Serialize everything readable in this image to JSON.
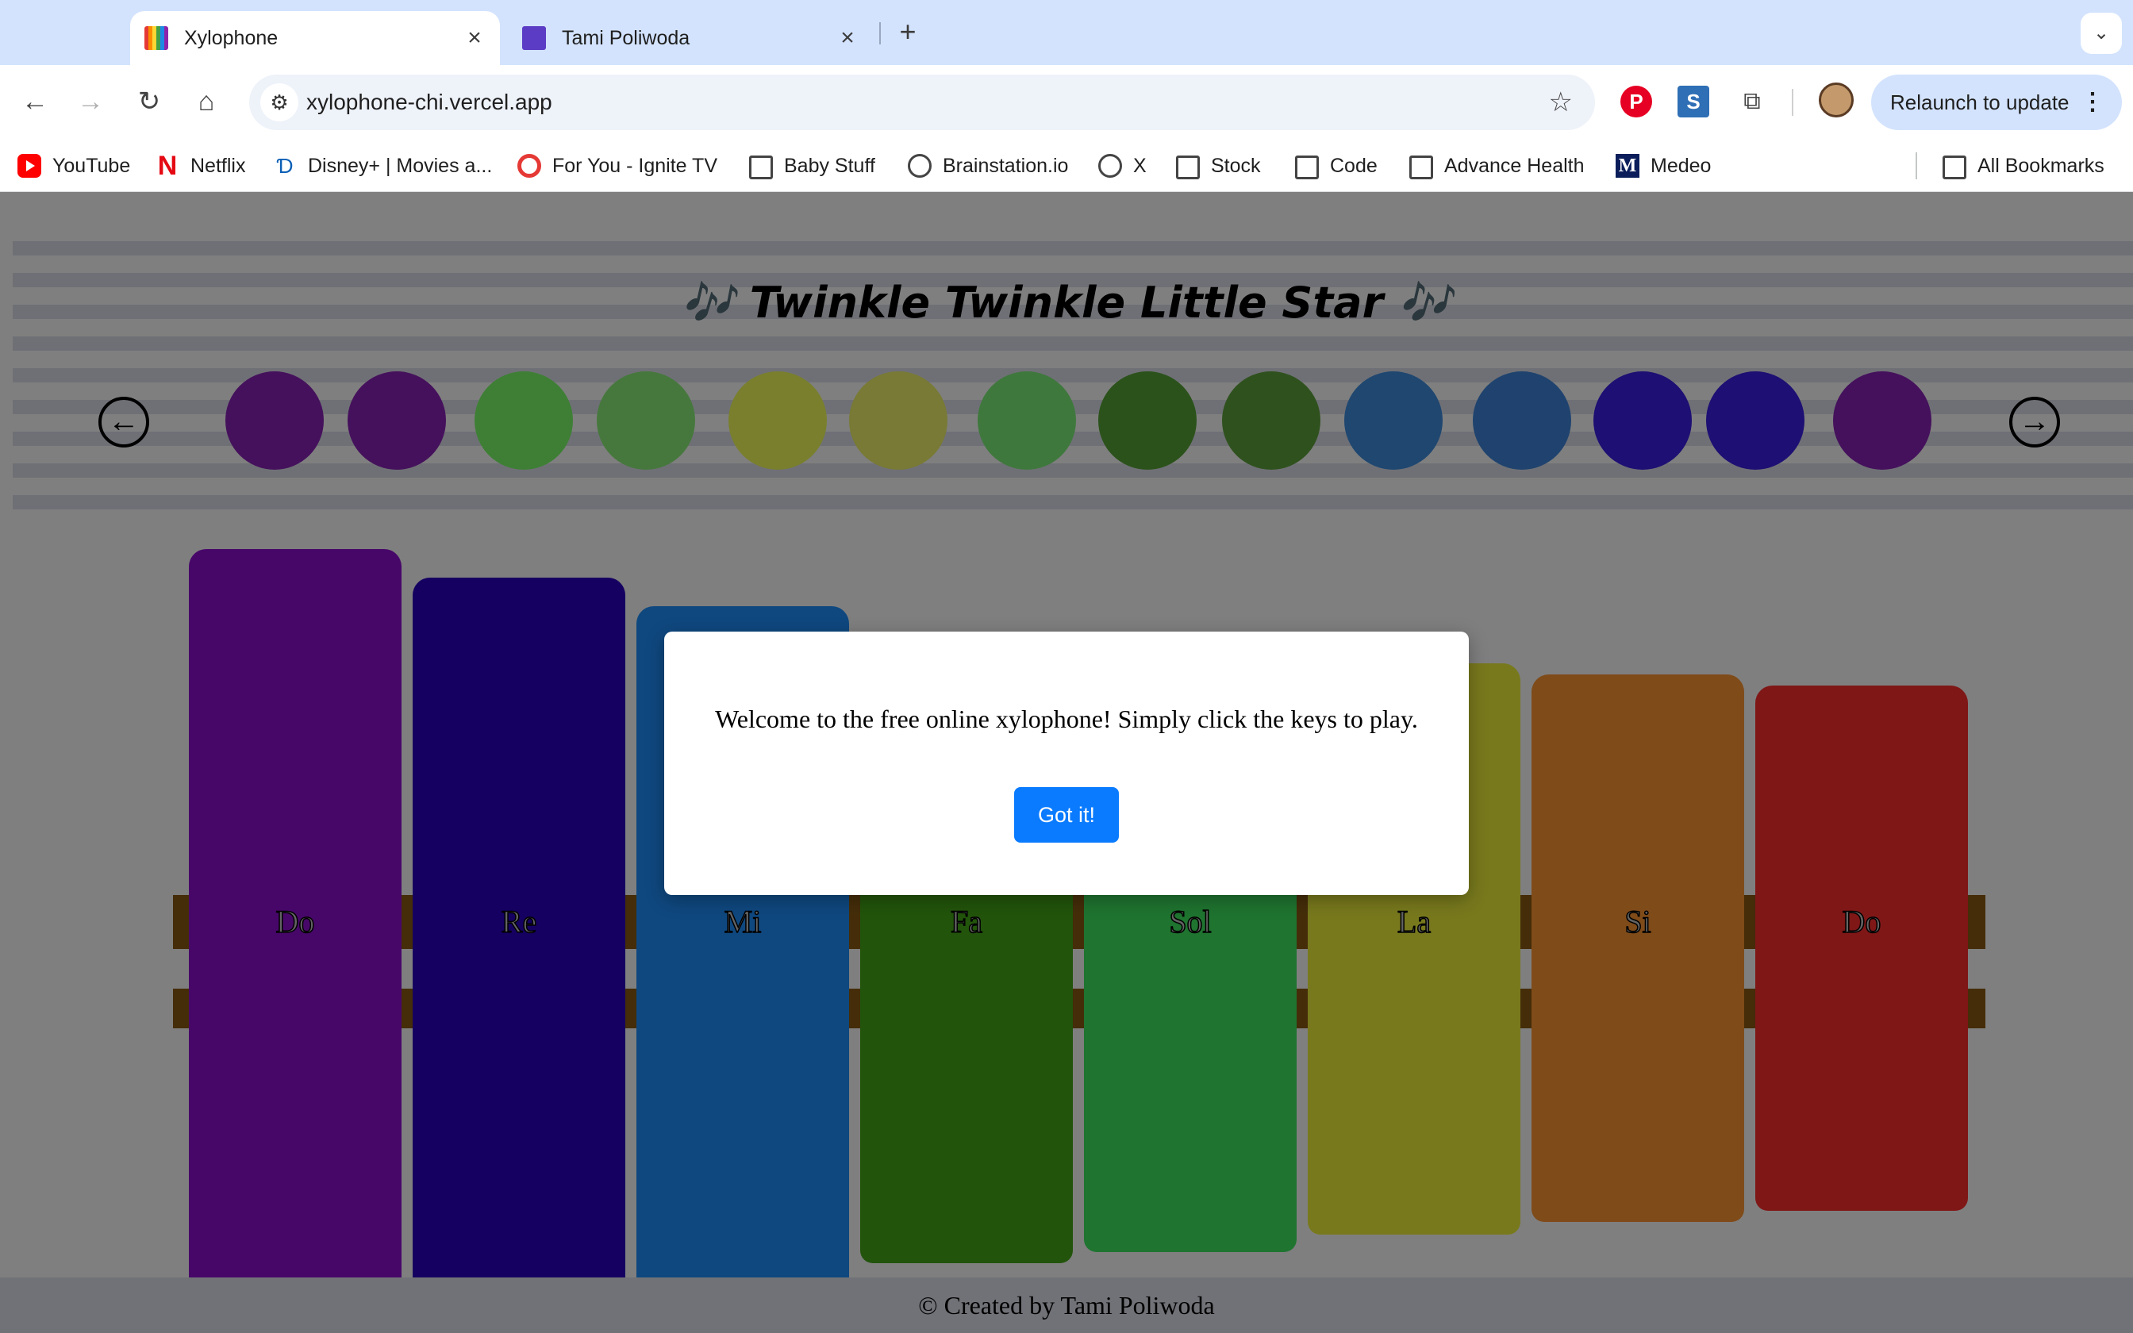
{
  "browser": {
    "tabs": [
      {
        "title": "Xylophone",
        "active": true,
        "icon": "rainbow-xylophone-icon"
      },
      {
        "title": "Tami Poliwoda",
        "active": false,
        "icon": "person-avatar-icon"
      }
    ],
    "new_tab_symbol": "+",
    "url": "xylophone-chi.vercel.app",
    "relaunch_label": "Relaunch to update",
    "bookmarks": [
      {
        "label": "YouTube",
        "icon": "youtube-icon"
      },
      {
        "label": "Netflix",
        "icon": "netflix-icon"
      },
      {
        "label": "Disney+ | Movies a...",
        "icon": "disney-icon"
      },
      {
        "label": "For You - Ignite TV",
        "icon": "ignite-icon"
      },
      {
        "label": "Baby Stuff",
        "icon": "folder-icon"
      },
      {
        "label": "Brainstation.io",
        "icon": "brain-icon"
      },
      {
        "label": "X",
        "icon": "brain-icon"
      },
      {
        "label": "Stock",
        "icon": "folder-icon"
      },
      {
        "label": "Code",
        "icon": "folder-icon"
      },
      {
        "label": "Advance Health",
        "icon": "folder-icon"
      },
      {
        "label": "Medeo",
        "icon": "medeo-icon"
      }
    ],
    "all_bookmarks_label": "All Bookmarks"
  },
  "page": {
    "song_title": "🎶 Twinkle Twinkle Little Star 🎶",
    "notes": [
      {
        "color": "#8a22b8"
      },
      {
        "color": "#8a22b8"
      },
      {
        "color": "#7dff6a"
      },
      {
        "color": "#8cf07a"
      },
      {
        "color": "#f3ff5a"
      },
      {
        "color": "#f0f46a"
      },
      {
        "color": "#7ef07a"
      },
      {
        "color": "#56a536"
      },
      {
        "color": "#5fa33c"
      },
      {
        "color": "#3f8ee0"
      },
      {
        "color": "#3f86dc"
      },
      {
        "color": "#3a1fe6"
      },
      {
        "color": "#3a1fe6"
      },
      {
        "color": "#8a22b8"
      }
    ],
    "keys": [
      {
        "label": "Do",
        "color": "#8f0fd2"
      },
      {
        "label": "Re",
        "color": "#2b00c3"
      },
      {
        "label": "Mi",
        "color": "#1f90ff"
      },
      {
        "label": "Fa",
        "color": "#44a817"
      },
      {
        "label": "Sol",
        "color": "#3ee860"
      },
      {
        "label": "La",
        "color": "#f0f23a"
      },
      {
        "label": "Si",
        "color": "#ff9633"
      },
      {
        "label": "Do",
        "color": "#ff2e2e"
      }
    ],
    "footer": "© Created by Tami Poliwoda"
  },
  "modal": {
    "message": "Welcome to the free online xylophone! Simply click the keys to play.",
    "button_label": "Got it!"
  }
}
